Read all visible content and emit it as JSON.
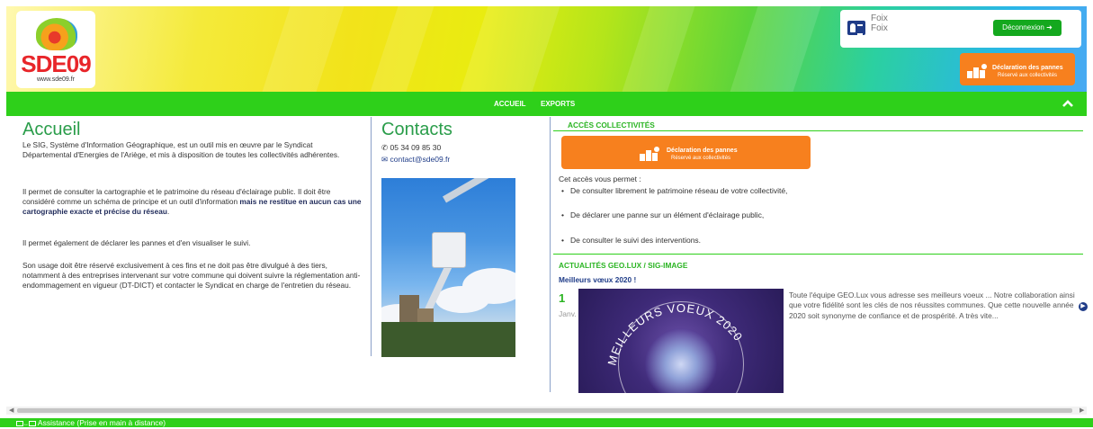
{
  "header": {
    "logo_text": "SDE09",
    "logo_url": "www.sde09.fr",
    "user": {
      "line1": "Foix",
      "line2": "Foix"
    },
    "logout_label": "Déconnexion",
    "panne_button": {
      "title": "Déclaration des pannes",
      "subtitle": "Réservé aux collectivités"
    }
  },
  "nav": {
    "items": [
      "ACCUEIL",
      "EXPORTS"
    ]
  },
  "accueil": {
    "title": "Accueil",
    "p1": "Le SIG, Système d'Information Géographique, est un outil mis en œuvre par le Syndicat Départemental d'Energies de l'Ariège, et mis à disposition de toutes les collectivités adhérentes.",
    "p2_a": "Il permet de consulter la cartographie et le patrimoine du réseau d'éclairage public. Il doit être considéré comme un schéma de principe et un outil d'information ",
    "p2_b": "mais ne restitue en aucun cas une cartographie exacte et précise du réseau",
    "p2_c": ".",
    "p3": "Il permet également de déclarer les pannes et d'en visualiser le suivi.",
    "p4": "Son usage doit être réservé exclusivement à ces fins et ne doit pas être divulgué à des tiers, notamment à des entreprises intervenant sur votre commune qui doivent suivre la réglementation anti-endommagement en vigueur (DT-DICT) et contacter le Syndicat en charge de l'entretien du réseau."
  },
  "contacts": {
    "title": "Contacts",
    "phone": "05 34 09 85 30",
    "email": "contact@sde09.fr"
  },
  "acces": {
    "title": "ACCÈS COLLECTIVITÉS",
    "intro": "Cet accès vous permet :",
    "items": [
      "De consulter librement le patrimoine réseau de votre collectivité,",
      "De déclarer une panne sur un élément d'éclairage public,",
      "De consulter le suivi des interventions."
    ]
  },
  "actualites": {
    "title": "ACTUALITÉS GEO.LUX / SIG-IMAGE",
    "news_title": "Meilleurs vœux 2020 !",
    "day": "1",
    "month": "Janv.",
    "image_text": "MEILLEURS VOEUX 2020",
    "text": "Toute l'équipe GEO.Lux vous adresse ses meilleurs voeux ... Notre collaboration ainsi que votre fidélité sont les clés de nos réussites communes. Que cette nouvelle année 2020 soit synonyme de confiance et de prospérité. A très vite..."
  },
  "footer": {
    "label": "Assistance (Prise en main à distance)"
  },
  "colors": {
    "green": "#2ed01a",
    "orange": "#f7801e",
    "navy": "#1f3c88",
    "heading_green": "#2a9d4a"
  }
}
